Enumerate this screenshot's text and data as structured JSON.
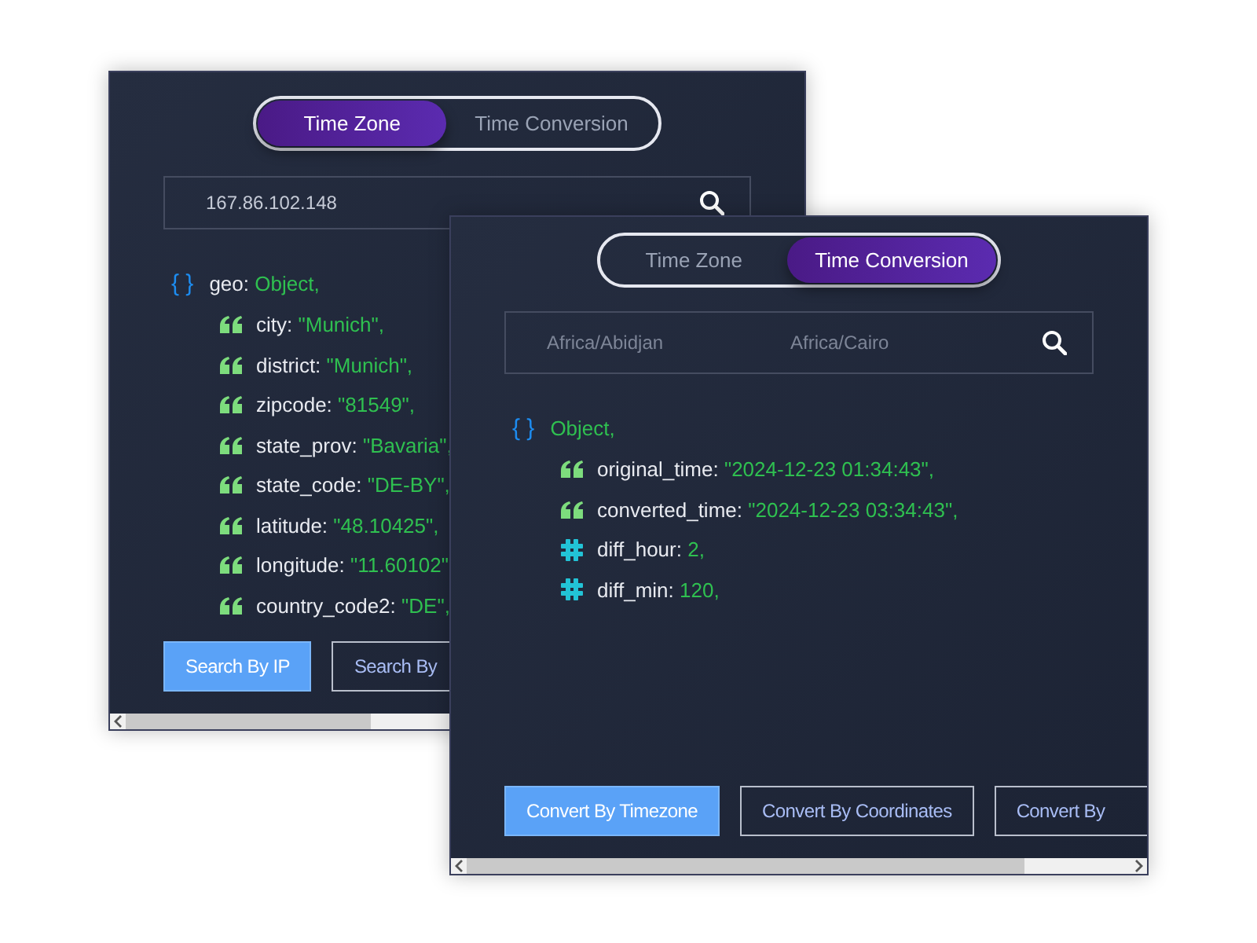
{
  "windows": [
    {
      "tabs": [
        {
          "label": "Time Zone",
          "selected": true
        },
        {
          "label": "Time Conversion",
          "selected": false
        }
      ],
      "search": {
        "inputs": [
          {
            "value": "167.86.102.148"
          }
        ]
      },
      "result": {
        "brace": "{ }",
        "key": "geo:",
        "value": "Object,"
      },
      "fields": [
        {
          "kind": "string",
          "key": "city:",
          "value": "\"Munich\","
        },
        {
          "kind": "string",
          "key": "district:",
          "value": "\"Munich\","
        },
        {
          "kind": "string",
          "key": "zipcode:",
          "value": "\"81549\","
        },
        {
          "kind": "string",
          "key": "state_prov:",
          "value": "\"Bavaria\","
        },
        {
          "kind": "string",
          "key": "state_code:",
          "value": "\"DE-BY\","
        },
        {
          "kind": "string",
          "key": "latitude:",
          "value": "\"48.10425\","
        },
        {
          "kind": "string",
          "key": "longitude:",
          "value": "\"11.60102\""
        },
        {
          "kind": "string",
          "key": "country_code2:",
          "value": "\"DE\","
        }
      ],
      "buttons": [
        {
          "label": "Search By IP",
          "selected": true
        },
        {
          "label": "Search By",
          "selected": false
        }
      ]
    },
    {
      "tabs": [
        {
          "label": "Time Zone",
          "selected": false
        },
        {
          "label": "Time Conversion",
          "selected": true
        }
      ],
      "search": {
        "inputs": [
          {
            "placeholder": "Africa/Abidjan"
          },
          {
            "placeholder": "Africa/Cairo"
          }
        ]
      },
      "result": {
        "brace": "{ }",
        "value": "Object,"
      },
      "fields": [
        {
          "kind": "string",
          "key": "original_time:",
          "value": "\"2024-12-23 01:34:43\","
        },
        {
          "kind": "string",
          "key": "converted_time:",
          "value": "\"2024-12-23 03:34:43\","
        },
        {
          "kind": "number",
          "key": "diff_hour:",
          "value": "2,"
        },
        {
          "kind": "number",
          "key": "diff_min:",
          "value": "120,"
        }
      ],
      "buttons": [
        {
          "label": "Convert By Timezone",
          "selected": true
        },
        {
          "label": "Convert By Coordinates",
          "selected": false
        },
        {
          "label": "Convert By",
          "selected": false
        }
      ]
    }
  ]
}
